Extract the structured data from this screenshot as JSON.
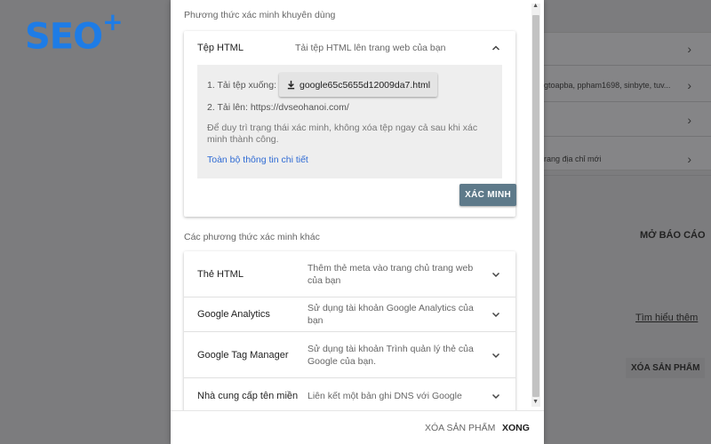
{
  "logo": {
    "text": "SEO",
    "plus": "+"
  },
  "background": {
    "rows": [
      {
        "text": ""
      },
      {
        "text": "gtoapba, ppham1698, sinbyte, tuv..."
      },
      {
        "text": ""
      },
      {
        "text": "rang địa chỉ mới"
      }
    ],
    "open_report": "MỞ BÁO CÁO",
    "learn_more": "Tìm hiểu thêm",
    "remove_product": "XÓA SẢN PHẨM"
  },
  "modal": {
    "recommended_title": "Phương thức xác minh khuyên dùng",
    "html_file": {
      "name": "Tệp HTML",
      "description": "Tải tệp HTML lên trang web của bạn",
      "step1_label": "1. Tải tệp xuống:",
      "download_file": "google65c5655d12009da7.html",
      "step2_label": "2. Tải lên:",
      "step2_url": "https://dvseohanoi.com/",
      "note": "Để duy trì trạng thái xác minh, không xóa tệp ngay cả sau khi xác minh thành công.",
      "details_link": "Toàn bộ thông tin chi tiết",
      "verify_button": "XÁC MINH"
    },
    "other_title": "Các phương thức xác minh khác",
    "other_methods": [
      {
        "name": "Thẻ HTML",
        "description": "Thêm thẻ meta vào trang chủ trang web của bạn"
      },
      {
        "name": "Google Analytics",
        "description": "Sử dụng tài khoản Google Analytics của bạn"
      },
      {
        "name": "Google Tag Manager",
        "description": "Sử dụng tài khoản Trình quản lý thẻ của Google của bạn."
      },
      {
        "name": "Nhà cung cấp tên miền",
        "description": "Liên kết một bản ghi DNS với Google"
      }
    ],
    "footer": {
      "remove": "XÓA SẢN PHẨM",
      "done": "XONG"
    }
  },
  "colors": {
    "overlay": "#7c7c7e",
    "accent_link": "#2f6bd4",
    "verify_button": "#5e7a8a",
    "logo": "#1e7ce6"
  }
}
